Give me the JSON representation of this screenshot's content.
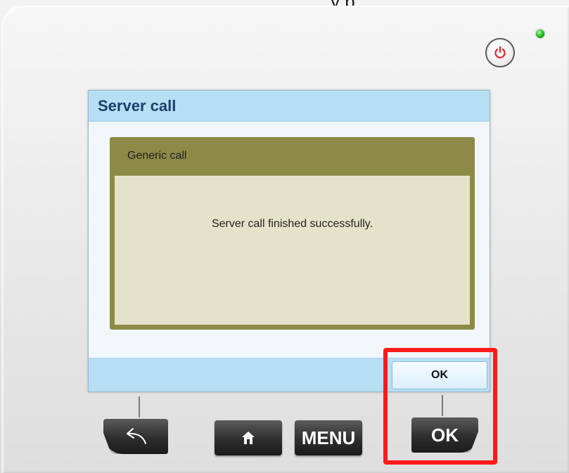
{
  "top_text": "y        p",
  "screen": {
    "title": "Server call",
    "dialog": {
      "header": "Generic call",
      "message": "Server call finished successfully."
    },
    "softkey_ok_label": "OK"
  },
  "hardware_keys": {
    "back_icon": "back-arrow-icon",
    "home_icon": "home-icon",
    "menu_label": "MENU",
    "ok_label": "OK"
  },
  "icons": {
    "power": "power-icon",
    "led": "status-led"
  },
  "colors": {
    "title_bar": "#b6dff3",
    "dialog_header": "#8d8a47",
    "dialog_body": "#e4e3c9",
    "highlight": "#ff1a1a",
    "led": "#1db31d",
    "power": "#e0242a"
  }
}
